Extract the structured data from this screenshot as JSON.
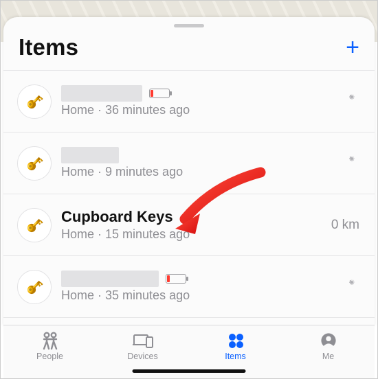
{
  "header": {
    "title": "Items"
  },
  "items": [
    {
      "name": null,
      "redactWidth": 118,
      "location": "Home",
      "time": "36 minutes ago",
      "lowBattery": true,
      "distance": null,
      "loading": true
    },
    {
      "name": null,
      "redactWidth": 84,
      "location": "Home",
      "time": "9 minutes ago",
      "lowBattery": false,
      "distance": null,
      "loading": true
    },
    {
      "name": "Cupboard Keys",
      "redactWidth": 0,
      "location": "Home",
      "time": "15 minutes ago",
      "lowBattery": false,
      "distance": "0 km",
      "loading": false
    },
    {
      "name": null,
      "redactWidth": 142,
      "location": "Home",
      "time": "35 minutes ago",
      "lowBattery": true,
      "distance": null,
      "loading": true
    }
  ],
  "tabs": {
    "people": "People",
    "devices": "Devices",
    "items": "Items",
    "me": "Me",
    "active": "items"
  }
}
